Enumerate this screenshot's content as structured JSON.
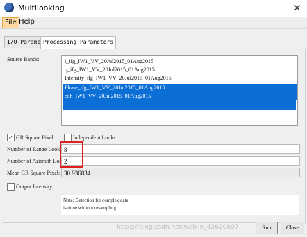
{
  "window": {
    "title": "Multilooking"
  },
  "menu": {
    "file": "File",
    "help": "Help"
  },
  "tabs": [
    {
      "label": "I/O Parameters"
    },
    {
      "label": "Processing Parameters"
    }
  ],
  "source_bands": {
    "label": "Source Bands:",
    "items": [
      {
        "text": "i_ifg_IW1_VV_20Jul2015_01Aug2015",
        "selected": false
      },
      {
        "text": "q_ifg_IW1_VV_20Jul2015_01Aug2015",
        "selected": false
      },
      {
        "text": "Intensity_ifg_IW1_VV_20Jul2015_01Aug2015",
        "selected": false
      },
      {
        "text": "Phase_ifg_IW1_VV_20Jul2015_01Aug2015",
        "selected": true
      },
      {
        "text": "coh_IW1_VV_20Jul2015_01Aug2015",
        "selected": true
      }
    ]
  },
  "options": {
    "gr_square_pixel": {
      "label": "GR Square Pixel",
      "checked": true
    },
    "independent_looks": {
      "label": "Independent Looks",
      "checked": false
    }
  },
  "fields": {
    "range_looks_label": "Number of Range Looks:",
    "range_looks_value": "8",
    "azimuth_looks_label": "Number of Azimuth Looks:",
    "azimuth_looks_value": "2",
    "mean_gr_label": "Mean GR Square Pixel:",
    "mean_gr_value": "30.936834"
  },
  "output_intensity": {
    "label": "Output Intensity",
    "checked": false
  },
  "note": {
    "line1": "Note: Detection for complex data",
    "line2": "is done without resampling."
  },
  "buttons": {
    "run": "Run",
    "close": "Close"
  },
  "watermark": "https://blog.csdn.net/weixin_42620697",
  "colors": {
    "selection": "#0b6fd6",
    "highlight_box": "#e02020",
    "menu_active": "#ffd9a3"
  }
}
